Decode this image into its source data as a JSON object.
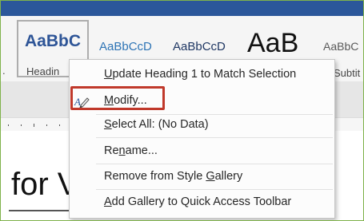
{
  "ribbon": {
    "styles": [
      {
        "sample": "AaBbC",
        "caption": "Headin"
      },
      {
        "sample": "AaBbCcD",
        "caption": ""
      },
      {
        "sample": "AaBbCcD",
        "caption": ""
      },
      {
        "sample": "AaB",
        "caption": ""
      },
      {
        "sample": "AaBbC",
        "caption": "Subtit"
      }
    ],
    "left_caption_fragment": "."
  },
  "context_menu": {
    "items": [
      {
        "prefix": "U",
        "rest": "pdate Heading 1 to Match Selection"
      },
      {
        "prefix": "M",
        "rest": "odify..."
      },
      {
        "prefix": "S",
        "rest": "elect All: (No Data)"
      },
      {
        "pre": "Re",
        "underline": "n",
        "post": "ame..."
      },
      {
        "pre": "Remove from Style ",
        "underline": "G",
        "post": "allery"
      },
      {
        "prefix": "A",
        "rest": "dd Gallery to Quick Access Toolbar"
      }
    ],
    "modify_icon": "pencil-style-icon",
    "highlight_color": "#c0392b"
  },
  "document": {
    "visible_text": "for V"
  },
  "colors": {
    "ribbon_blue": "#2b579a",
    "heading_blue": "#2e5597",
    "frame_green": "#7fb24b"
  }
}
